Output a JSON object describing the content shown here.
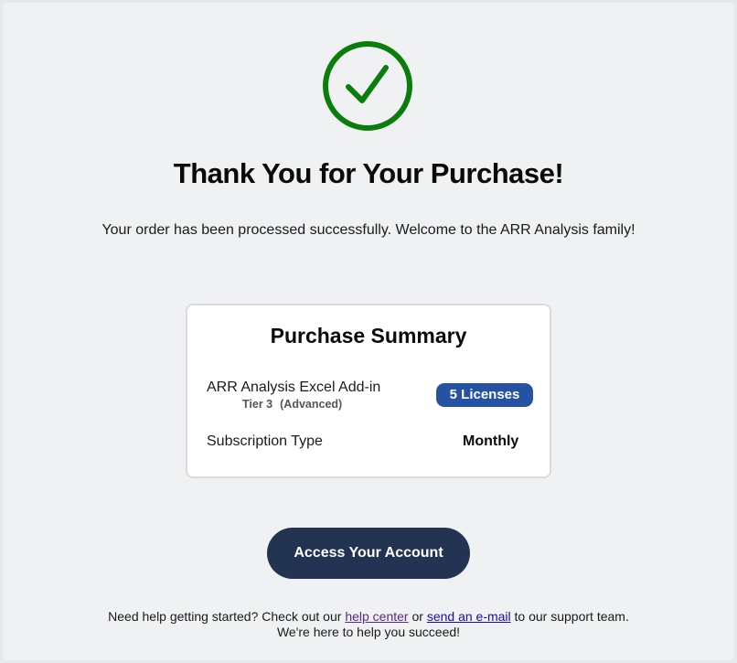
{
  "success_icon": {
    "name": "checkmark-circle-icon",
    "color": "#0a7d0a"
  },
  "header": {
    "title": "Thank You for Your Purchase!",
    "subtitle": "Your order has been processed successfully. Welcome to the ARR Analysis family!"
  },
  "summary": {
    "title": "Purchase Summary",
    "product_name": "ARR Analysis Excel Add-in",
    "tier": "Tier 3",
    "tier_level": "(Advanced)",
    "licenses_badge": "5 Licenses",
    "subscription_label": "Subscription Type",
    "subscription_value": "Monthly"
  },
  "cta": {
    "label": "Access Your Account"
  },
  "help": {
    "text_before": "Need help getting started? Check out our ",
    "help_center_link": "help center",
    "text_middle": " or ",
    "email_link": "send an e-mail",
    "text_after": " to our support team.",
    "line2": "We're here to help you succeed!"
  },
  "colors": {
    "success": "#0a7d0a",
    "badge": "#2552a3",
    "button": "#233452",
    "background": "#eff1f2"
  }
}
